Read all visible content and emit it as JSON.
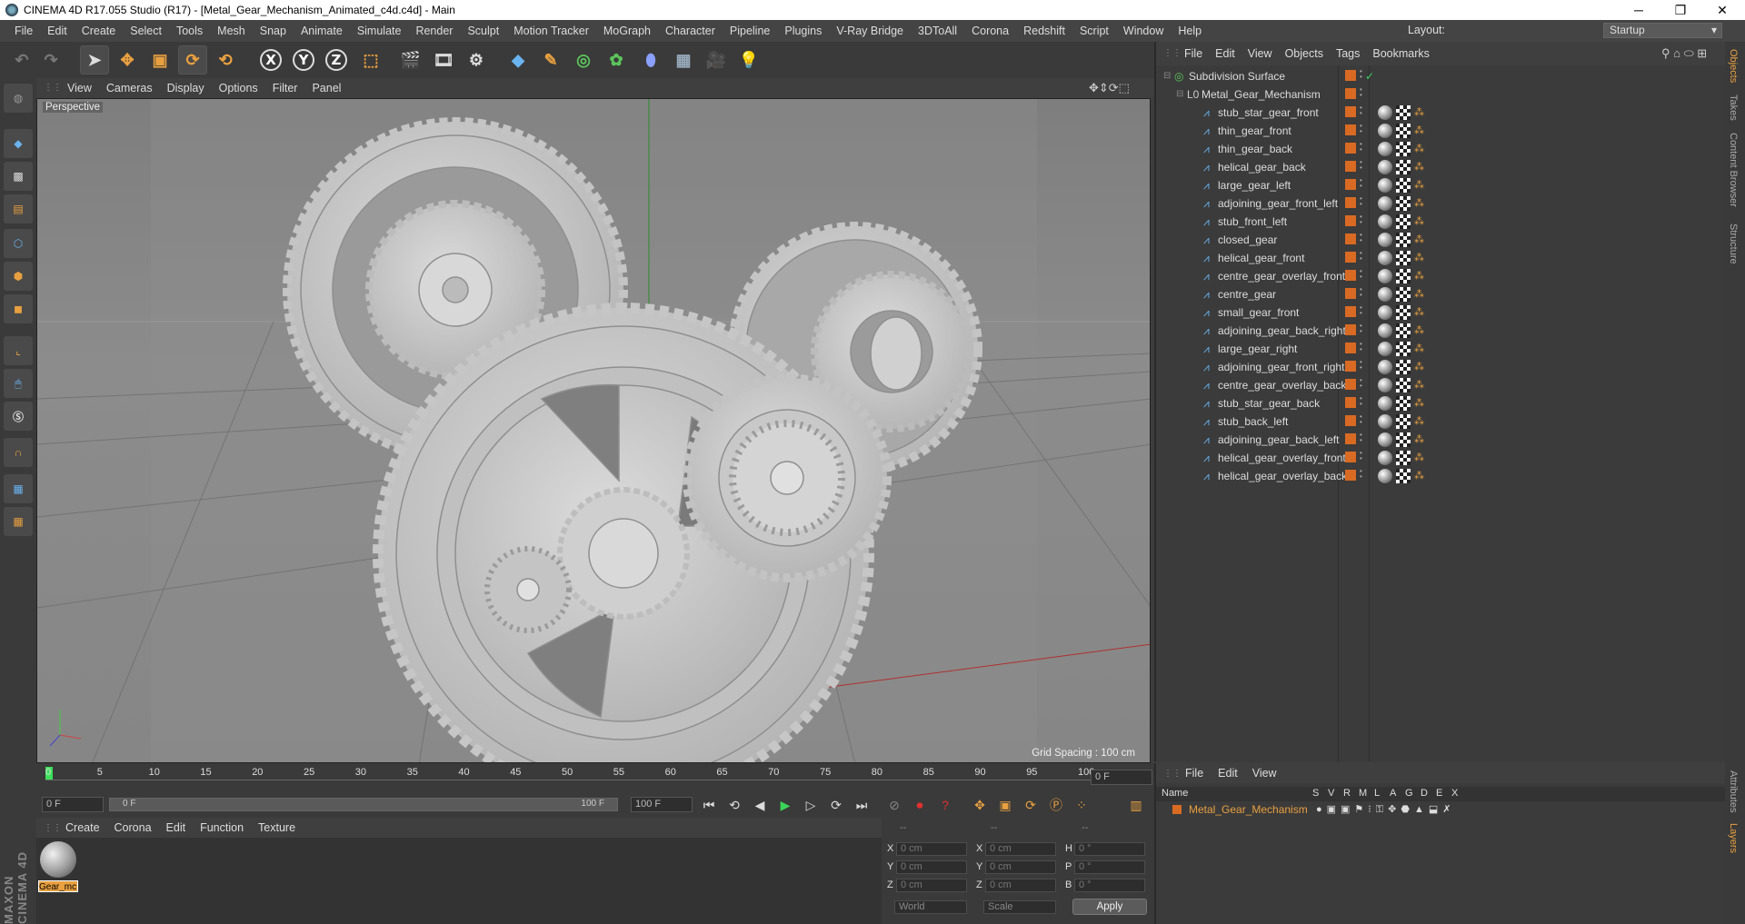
{
  "window": {
    "title": "CINEMA 4D R17.055 Studio (R17) - [Metal_Gear_Mechanism_Animated_c4d.c4d] - Main"
  },
  "menu": [
    "File",
    "Edit",
    "Create",
    "Select",
    "Tools",
    "Mesh",
    "Snap",
    "Animate",
    "Simulate",
    "Render",
    "Sculpt",
    "Motion Tracker",
    "MoGraph",
    "Character",
    "Pipeline",
    "Plugins",
    "V-Ray Bridge",
    "3DToAll",
    "Corona",
    "Redshift",
    "Script",
    "Window",
    "Help"
  ],
  "layout": {
    "label": "Layout:",
    "value": "Startup"
  },
  "viewport": {
    "menu": [
      "View",
      "Cameras",
      "Display",
      "Options",
      "Filter",
      "Panel"
    ],
    "label": "Perspective",
    "grid_spacing": "Grid Spacing : 100 cm"
  },
  "timeline": {
    "ticks": [
      "0",
      "5",
      "10",
      "15",
      "20",
      "25",
      "30",
      "35",
      "40",
      "45",
      "50",
      "55",
      "60",
      "65",
      "70",
      "75",
      "80",
      "85",
      "90",
      "95",
      "100"
    ],
    "current_frame": "0 F",
    "start": "0 F",
    "range_start": "0 F",
    "range_end": "100 F",
    "end": "100 F"
  },
  "material": {
    "menu": [
      "Create",
      "Corona",
      "Edit",
      "Function",
      "Texture"
    ],
    "name": "Gear_mc"
  },
  "coords": {
    "header": [
      "--",
      "--",
      "--"
    ],
    "rows": [
      [
        "X",
        "0 cm",
        "X",
        "0 cm",
        "H",
        "0 °"
      ],
      [
        "Y",
        "0 cm",
        "Y",
        "0 cm",
        "P",
        "0 °"
      ],
      [
        "Z",
        "0 cm",
        "Z",
        "0 cm",
        "B",
        "0 °"
      ]
    ],
    "world": "World",
    "scale": "Scale",
    "apply": "Apply"
  },
  "objects": {
    "menu": [
      "File",
      "Edit",
      "View",
      "Objects",
      "Tags",
      "Bookmarks"
    ],
    "root": "Subdivision Surface",
    "group": "Metal_Gear_Mechanism",
    "items": [
      "stub_star_gear_front",
      "thin_gear_front",
      "thin_gear_back",
      "helical_gear_back",
      "large_gear_left",
      "adjoining_gear_front_left",
      "stub_front_left",
      "closed_gear",
      "helical_gear_front",
      "centre_gear_overlay_front",
      "centre_gear",
      "small_gear_front",
      "adjoining_gear_back_right",
      "large_gear_right",
      "adjoining_gear_front_right",
      "centre_gear_overlay_back",
      "stub_star_gear_back",
      "stub_back_left",
      "adjoining_gear_back_left",
      "helical_gear_overlay_front",
      "helical_gear_overlay_back"
    ]
  },
  "layers": {
    "menu": [
      "File",
      "Edit",
      "View"
    ],
    "columns": [
      "Name",
      "S",
      "V",
      "R",
      "M",
      "L",
      "A",
      "G",
      "D",
      "E",
      "X"
    ],
    "row": "Metal_Gear_Mechanism"
  },
  "right_tabs": [
    "Objects",
    "Takes",
    "Content Browser",
    "Structure"
  ],
  "right_tabs_bottom": [
    "Attributes",
    "Layers"
  ],
  "brand": "MAXON CINEMA 4D"
}
